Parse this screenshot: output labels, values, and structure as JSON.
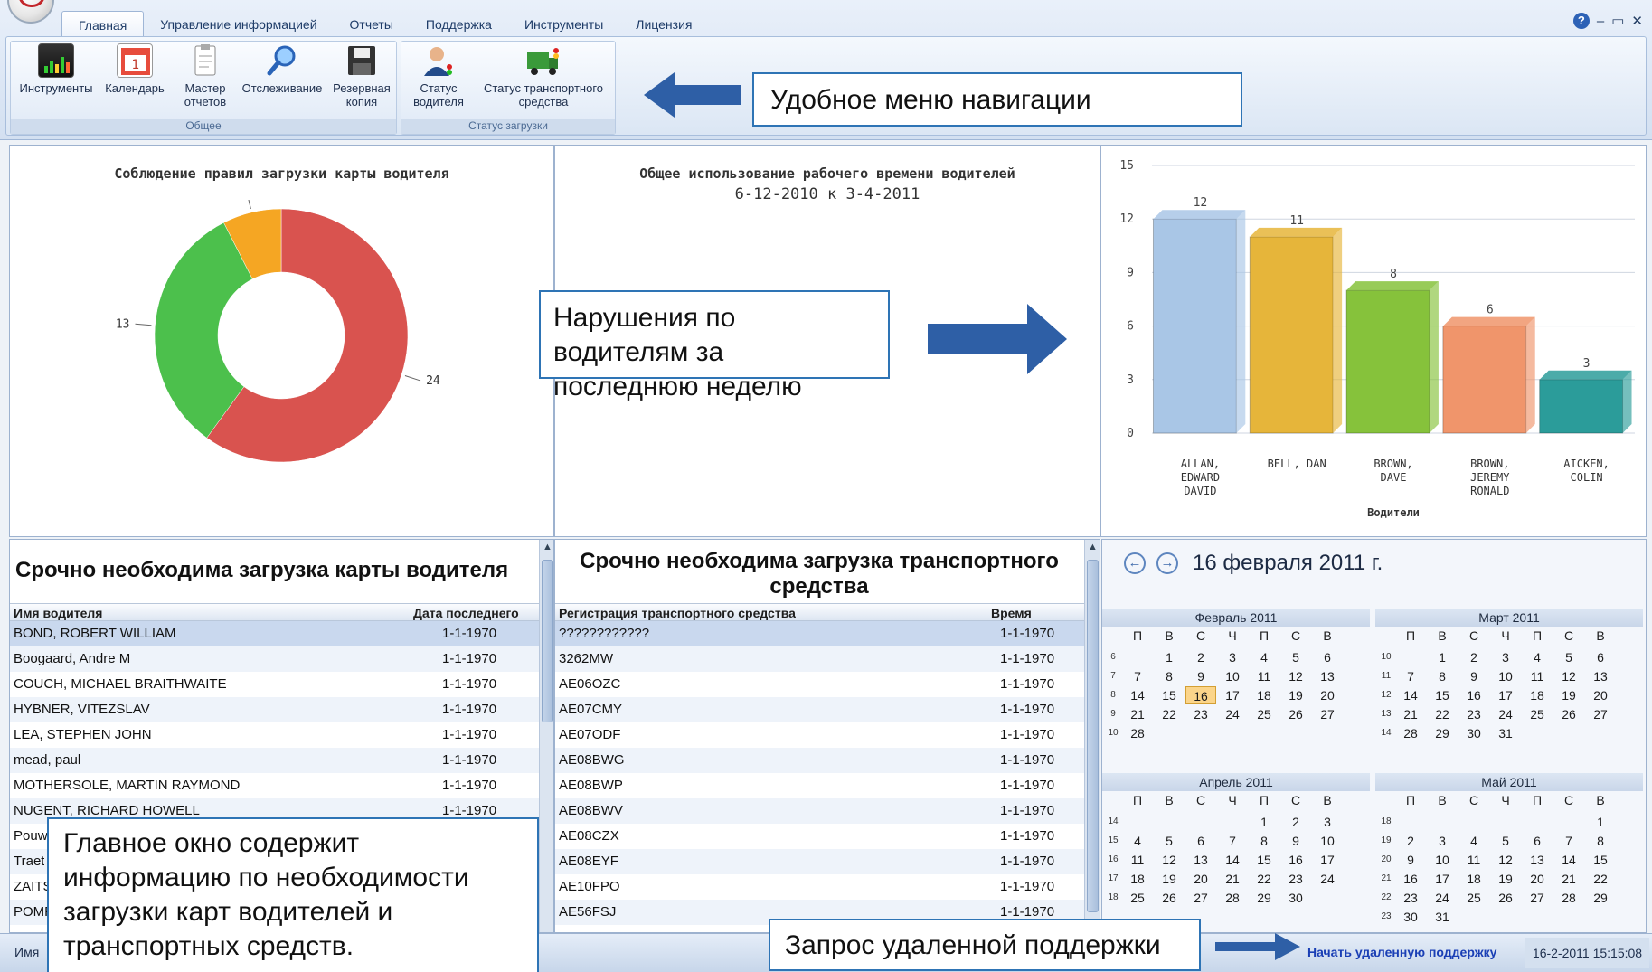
{
  "ribbon": {
    "tabs": [
      "Главная",
      "Управление информацией",
      "Отчеты",
      "Поддержка",
      "Инструменты",
      "Лицензия"
    ],
    "window_controls": {
      "help": "?",
      "minimize": "–",
      "restore": "▭",
      "close": "✕"
    },
    "groups": [
      {
        "title": "Общее",
        "buttons": [
          {
            "label": "Инструменты",
            "icon": "dashboard-icon"
          },
          {
            "label": "Календарь",
            "icon": "calendar-icon"
          },
          {
            "label": "Мастер отчетов",
            "icon": "report-wizard-icon"
          },
          {
            "label": "Отслеживание",
            "icon": "magnifier-icon"
          },
          {
            "label": "Резервная копия",
            "icon": "floppy-disk-icon"
          }
        ]
      },
      {
        "title": "Статус загрузки",
        "buttons": [
          {
            "label": "Статус водителя",
            "icon": "driver-status-icon"
          },
          {
            "label": "Статус транспортного средства",
            "icon": "truck-status-icon"
          }
        ]
      }
    ],
    "colors": {
      "accent": "#2e74b5"
    }
  },
  "donut_chart": {
    "title": "Соблюдение правил загрузки карты водителя",
    "chart_data": {
      "type": "pie",
      "title": "Соблюдение правил загрузки карты водителя",
      "slices": [
        {
          "value": 24,
          "color": "#d9534f"
        },
        {
          "value": 13,
          "color": "#4cc04c"
        },
        {
          "value": 3,
          "color": "#f5a623"
        }
      ]
    },
    "labels": [
      "24",
      "13",
      "3"
    ]
  },
  "work_time_chart": {
    "title": "Общее использование рабочего времени водителей",
    "subtitle": "6-12-2010 к 3-4-2011"
  },
  "bar_chart": {
    "chart_data": {
      "type": "bar",
      "categories": [
        "ALLAN, EDWARD DAVID",
        "BELL, DAN",
        "BROWN, DAVE",
        "BROWN, JEREMY RONALD",
        "AICKEN, COLIN"
      ],
      "values": [
        12,
        11,
        8,
        6,
        3
      ],
      "xlabel": "Водители",
      "ylabel": "",
      "ylim": [
        0,
        15
      ],
      "yticks": [
        0,
        3,
        6,
        9,
        12,
        15
      ],
      "colors": [
        "#a9c6e6",
        "#e6b53a",
        "#86c23b",
        "#f0956b",
        "#2b9c9a"
      ]
    },
    "xlabel": "Водители",
    "category_lines": [
      [
        "ALLAN,",
        "EDWARD",
        "DAVID"
      ],
      [
        "BELL, DAN"
      ],
      [
        "BROWN,",
        "DAVE"
      ],
      [
        "BROWN,",
        "JEREMY",
        "RONALD"
      ],
      [
        "AICKEN,",
        "COLIN"
      ]
    ],
    "ytick_labels": [
      "0",
      "3",
      "6",
      "9",
      "12",
      "15"
    ],
    "value_labels": [
      "12",
      "11",
      "8",
      "6",
      "3"
    ]
  },
  "driver_grid": {
    "title": "Срочно необходима загрузка карты водителя",
    "columns": [
      "Имя водителя",
      "Дата последнего"
    ],
    "rows": [
      [
        "BOND, ROBERT WILLIAM",
        "1-1-1970"
      ],
      [
        "Boogaard, Andre M",
        "1-1-1970"
      ],
      [
        "COUCH, MICHAEL BRAITHWAITE",
        "1-1-1970"
      ],
      [
        "HYBNER, VITEZSLAV",
        "1-1-1970"
      ],
      [
        "LEA, STEPHEN JOHN",
        "1-1-1970"
      ],
      [
        "mead, paul",
        "1-1-1970"
      ],
      [
        "MOTHERSOLE, MARTIN RAYMOND",
        "1-1-1970"
      ],
      [
        "NUGENT, RICHARD HOWELL",
        "1-1-1970"
      ],
      [
        "Pouw",
        ""
      ],
      [
        "Traet",
        ""
      ],
      [
        "ZAITS",
        ""
      ],
      [
        "POMF",
        ""
      ]
    ]
  },
  "vehicle_grid": {
    "title_line1": "Срочно необходима загрузка транспортного",
    "title_line2": "средства",
    "columns": [
      "Регистрация транспортного средства",
      "Время"
    ],
    "rows": [
      [
        "????????????",
        "1-1-1970"
      ],
      [
        "3262MW",
        "1-1-1970"
      ],
      [
        "AE06OZC",
        "1-1-1970"
      ],
      [
        "AE07CMY",
        "1-1-1970"
      ],
      [
        "AE07ODF",
        "1-1-1970"
      ],
      [
        "AE08BWG",
        "1-1-1970"
      ],
      [
        "AE08BWP",
        "1-1-1970"
      ],
      [
        "AE08BWV",
        "1-1-1970"
      ],
      [
        "AE08CZX",
        "1-1-1970"
      ],
      [
        "AE08EYF",
        "1-1-1970"
      ],
      [
        "AE10FPO",
        "1-1-1970"
      ],
      [
        "AE56FSJ",
        "1-1-1970"
      ]
    ]
  },
  "calendar": {
    "current_date": "16 февраля 2011 г.",
    "day_headers": [
      "П",
      "В",
      "С",
      "Ч",
      "П",
      "С",
      "В"
    ],
    "months": [
      {
        "title": "Февраль 2011",
        "weeks": [
          {
            "week": "6",
            "days": [
              "",
              "1",
              "2",
              "3",
              "4",
              "5",
              "6"
            ]
          },
          {
            "week": "7",
            "days": [
              "7",
              "8",
              "9",
              "10",
              "11",
              "12",
              "13"
            ]
          },
          {
            "week": "8",
            "days": [
              "14",
              "15",
              "16",
              "17",
              "18",
              "19",
              "20"
            ]
          },
          {
            "week": "9",
            "days": [
              "21",
              "22",
              "23",
              "24",
              "25",
              "26",
              "27"
            ]
          },
          {
            "week": "10",
            "days": [
              "28",
              "",
              "",
              "",
              "",
              "",
              ""
            ]
          }
        ],
        "today": "16"
      },
      {
        "title": "Март 2011",
        "weeks": [
          {
            "week": "10",
            "days": [
              "",
              "1",
              "2",
              "3",
              "4",
              "5",
              "6"
            ]
          },
          {
            "week": "11",
            "days": [
              "7",
              "8",
              "9",
              "10",
              "11",
              "12",
              "13"
            ]
          },
          {
            "week": "12",
            "days": [
              "14",
              "15",
              "16",
              "17",
              "18",
              "19",
              "20"
            ]
          },
          {
            "week": "13",
            "days": [
              "21",
              "22",
              "23",
              "24",
              "25",
              "26",
              "27"
            ]
          },
          {
            "week": "14",
            "days": [
              "28",
              "29",
              "30",
              "31",
              "",
              "",
              ""
            ]
          }
        ],
        "today": ""
      },
      {
        "title": "Апрель 2011",
        "weeks": [
          {
            "week": "14",
            "days": [
              "",
              "",
              "",
              "",
              "1",
              "2",
              "3"
            ]
          },
          {
            "week": "15",
            "days": [
              "4",
              "5",
              "6",
              "7",
              "8",
              "9",
              "10"
            ]
          },
          {
            "week": "16",
            "days": [
              "11",
              "12",
              "13",
              "14",
              "15",
              "16",
              "17"
            ]
          },
          {
            "week": "17",
            "days": [
              "18",
              "19",
              "20",
              "21",
              "22",
              "23",
              "24"
            ]
          },
          {
            "week": "18",
            "days": [
              "25",
              "26",
              "27",
              "28",
              "29",
              "30",
              ""
            ]
          }
        ],
        "today": ""
      },
      {
        "title": "Май 2011",
        "weeks": [
          {
            "week": "18",
            "days": [
              "",
              "",
              "",
              "",
              "",
              "",
              "1"
            ]
          },
          {
            "week": "19",
            "days": [
              "2",
              "3",
              "4",
              "5",
              "6",
              "7",
              "8"
            ]
          },
          {
            "week": "20",
            "days": [
              "9",
              "10",
              "11",
              "12",
              "13",
              "14",
              "15"
            ]
          },
          {
            "week": "21",
            "days": [
              "16",
              "17",
              "18",
              "19",
              "20",
              "21",
              "22"
            ]
          },
          {
            "week": "22",
            "days": [
              "23",
              "24",
              "25",
              "26",
              "27",
              "28",
              "29"
            ]
          },
          {
            "week": "23",
            "days": [
              "30",
              "31",
              "",
              "",
              "",
              "",
              ""
            ]
          }
        ],
        "today": ""
      }
    ]
  },
  "statusbar": {
    "left_label": "Имя",
    "remote_link": "Начать удаленную поддержку",
    "datetime": "16-2-2011 15:15:08"
  },
  "callouts": {
    "nav_menu": "Удобное меню навигации",
    "violations": "Нарушения по водителям за последнюю неделю",
    "main_window": "Главное окно содержит информацию по необходимости загрузки карт водителей и транспортных средств.",
    "remote_support": "Запрос удаленной поддержки"
  }
}
